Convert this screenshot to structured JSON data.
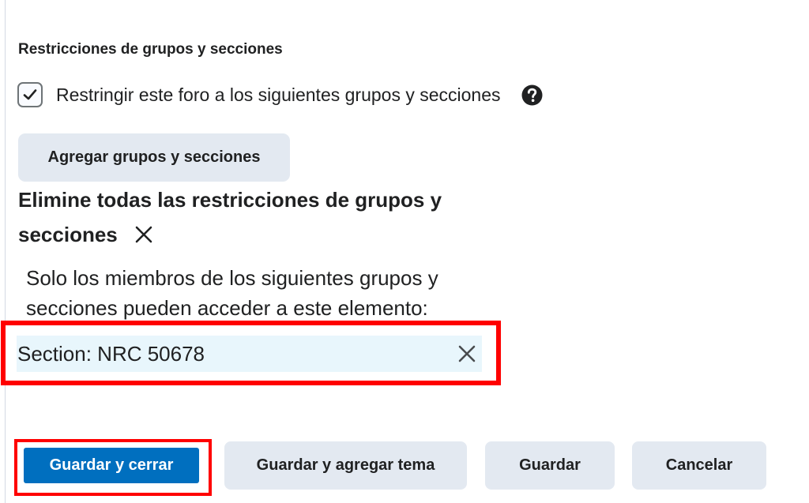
{
  "restrictions": {
    "heading": "Restricciones de grupos y secciones",
    "checkbox_label": "Restringir este foro a los siguientes grupos y secciones",
    "checkbox_checked": true,
    "add_button_label": "Agregar grupos y secciones",
    "remove_all_label": "Elimine todas las restricciones de grupos y secciones",
    "info_text": "Solo los miembros de los siguientes grupos y secciones pueden acceder a este elemento:",
    "items": [
      {
        "label": "Section: NRC 50678"
      }
    ]
  },
  "footer": {
    "save_close": "Guardar y cerrar",
    "save_add_topic": "Guardar y agregar tema",
    "save": "Guardar",
    "cancel": "Cancelar"
  },
  "colors": {
    "primary": "#006fbf",
    "secondary_button": "#e3e9f1",
    "highlight": "#ff0000",
    "selected_item_bg": "#e8f6fc"
  },
  "icons": {
    "checkbox": "checkmark-icon",
    "help": "help-circle-icon",
    "remove": "close-icon"
  }
}
